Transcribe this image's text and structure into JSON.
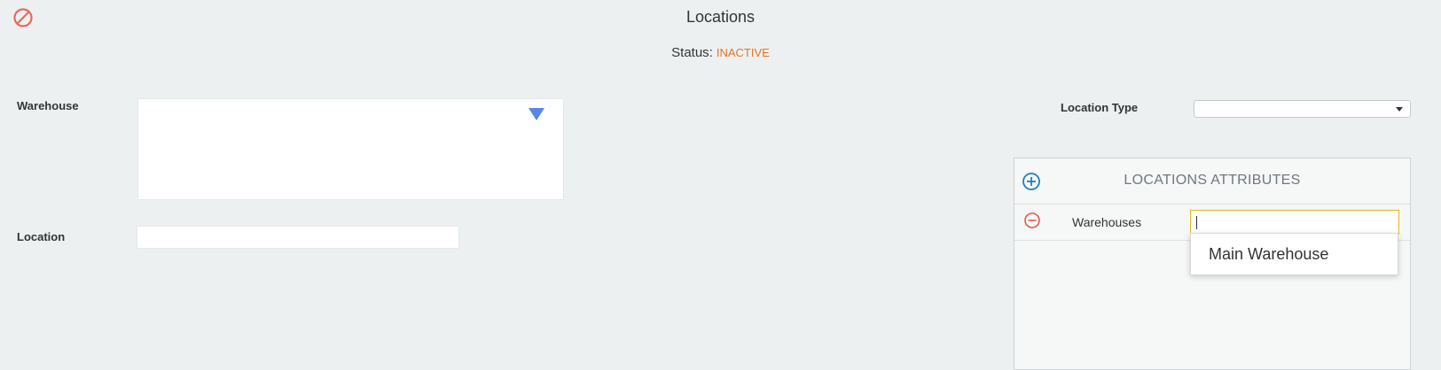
{
  "header": {
    "title": "Locations",
    "status_label": "Status:",
    "status_value": "INACTIVE",
    "status_icon": "prohibited-icon"
  },
  "form": {
    "warehouse_label": "Warehouse",
    "location_label": "Location",
    "location_value": "",
    "location_type_label": "Location Type",
    "location_type_selected": ""
  },
  "attributes": {
    "title": "LOCATIONS ATTRIBUTES",
    "add_icon": "plus-circle-icon",
    "remove_icon": "minus-circle-icon",
    "rows": [
      {
        "label": "Warehouses",
        "value": ""
      }
    ],
    "suggestions": [
      "Main Warehouse"
    ]
  },
  "colors": {
    "background": "#edf0f1",
    "status_inactive": "#e4761f",
    "inactive_icon": "#e8685c",
    "add_icon": "#1f7fc2",
    "remove_icon": "#e0584a",
    "dropdown_arrow": "#5b86e5",
    "input_focus_border": "#e6b623"
  }
}
